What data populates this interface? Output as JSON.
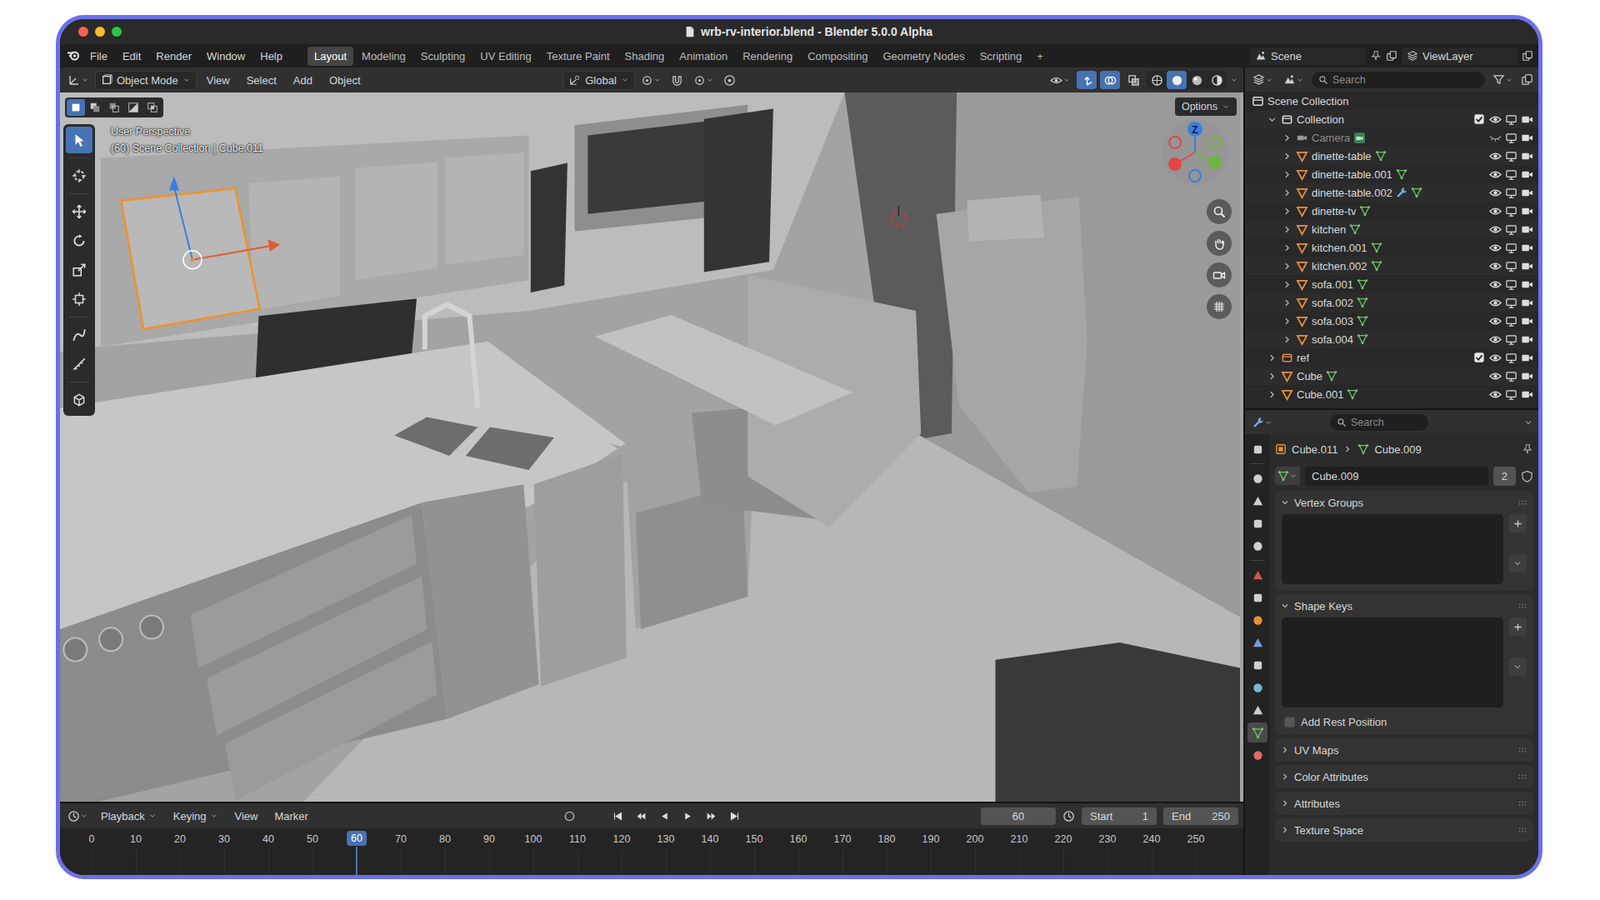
{
  "window": {
    "title": "wrb-rv-interior.blend - Blender 5.0.0 Alpha"
  },
  "menu": [
    "File",
    "Edit",
    "Render",
    "Window",
    "Help"
  ],
  "workspaces": [
    {
      "label": "Layout",
      "selected": true
    },
    {
      "label": "Modeling",
      "selected": false
    },
    {
      "label": "Sculpting",
      "selected": false
    },
    {
      "label": "UV Editing",
      "selected": false
    },
    {
      "label": "Texture Paint",
      "selected": false
    },
    {
      "label": "Shading",
      "selected": false
    },
    {
      "label": "Animation",
      "selected": false
    },
    {
      "label": "Rendering",
      "selected": false
    },
    {
      "label": "Compositing",
      "selected": false
    },
    {
      "label": "Geometry Nodes",
      "selected": false
    },
    {
      "label": "Scripting",
      "selected": false
    }
  ],
  "workspace_add": "+",
  "scene": "Scene",
  "view_layer": "ViewLayer",
  "viewport": {
    "mode": "Object Mode",
    "menus": [
      "View",
      "Select",
      "Add",
      "Object"
    ],
    "orientation": "Global",
    "options": "Options",
    "view_name": "User Perspective",
    "view_info": "(60) Scene Collection | Cube.011",
    "gizmo_axis": "Z",
    "select_modes": [
      {
        "selected": true
      },
      {
        "selected": false
      },
      {
        "selected": false
      },
      {
        "selected": false
      },
      {
        "selected": false
      }
    ],
    "shading": [
      {
        "selected": false
      },
      {
        "selected": true
      },
      {
        "selected": false
      },
      {
        "selected": false
      }
    ],
    "tools": [
      {
        "selected": true
      },
      {
        "selected": false
      },
      {
        "selected": false
      },
      {
        "selected": false
      },
      {
        "selected": false
      },
      {
        "selected": false
      },
      {
        "selected": false
      },
      {
        "selected": false
      },
      {
        "selected": false
      }
    ]
  },
  "outliner": {
    "search": "Search",
    "root": "Scene Collection",
    "tree": [
      {
        "name": "Collection",
        "kind": "collection",
        "color": "#d6d6d6",
        "expanded": true,
        "checked": true,
        "hidden": false,
        "dimmed": false,
        "has_modifier": false,
        "children": [
          {
            "name": "Camera",
            "kind": "camera",
            "expanded": false,
            "hidden": true,
            "dimmed": true,
            "has_modifier": false
          },
          {
            "name": "dinette-table",
            "kind": "mesh",
            "expanded": false,
            "hidden": false,
            "dimmed": false,
            "has_modifier": false
          },
          {
            "name": "dinette-table.001",
            "kind": "mesh",
            "expanded": false,
            "hidden": false,
            "dimmed": false,
            "has_modifier": false
          },
          {
            "name": "dinette-table.002",
            "kind": "mesh",
            "expanded": false,
            "hidden": false,
            "dimmed": false,
            "has_modifier": true
          },
          {
            "name": "dinette-tv",
            "kind": "mesh",
            "expanded": false,
            "hidden": false,
            "dimmed": false,
            "has_modifier": false
          },
          {
            "name": "kitchen",
            "kind": "mesh",
            "expanded": false,
            "hidden": false,
            "dimmed": false,
            "has_modifier": false
          },
          {
            "name": "kitchen.001",
            "kind": "mesh",
            "expanded": false,
            "hidden": false,
            "dimmed": false,
            "has_modifier": false
          },
          {
            "name": "kitchen.002",
            "kind": "mesh",
            "expanded": false,
            "hidden": false,
            "dimmed": false,
            "has_modifier": false
          },
          {
            "name": "sofa.001",
            "kind": "mesh",
            "expanded": false,
            "hidden": false,
            "dimmed": false,
            "has_modifier": false
          },
          {
            "name": "sofa.002",
            "kind": "mesh",
            "expanded": false,
            "hidden": false,
            "dimmed": false,
            "has_modifier": false
          },
          {
            "name": "sofa.003",
            "kind": "mesh",
            "expanded": false,
            "hidden": false,
            "dimmed": false,
            "has_modifier": false
          },
          {
            "name": "sofa.004",
            "kind": "mesh",
            "expanded": false,
            "hidden": false,
            "dimmed": false,
            "has_modifier": false
          }
        ]
      },
      {
        "name": "ref",
        "kind": "collection",
        "color": "#e08a3c",
        "expanded": false,
        "checked": true,
        "hidden": false,
        "dimmed": false,
        "has_modifier": false,
        "children": []
      },
      {
        "name": "Cube",
        "kind": "mesh",
        "expanded": false,
        "hidden": false,
        "dimmed": false,
        "has_modifier": false
      },
      {
        "name": "Cube.001",
        "kind": "mesh",
        "expanded": false,
        "hidden": false,
        "dimmed": false,
        "has_modifier": false
      }
    ]
  },
  "properties": {
    "search": "Search",
    "tabs": [
      {
        "selected": false
      },
      {
        "selected": false
      },
      {
        "selected": false
      },
      {
        "selected": false
      },
      {
        "selected": false
      },
      {
        "selected": false
      },
      {
        "selected": false
      },
      {
        "selected": false
      },
      {
        "selected": false
      },
      {
        "selected": false
      },
      {
        "selected": false
      },
      {
        "selected": false
      },
      {
        "selected": true
      },
      {
        "selected": false
      }
    ],
    "object": "Cube.011",
    "mesh": "Cube.009",
    "datablock": "Cube.009",
    "users": "2",
    "panels": [
      {
        "title": "Vertex Groups",
        "expanded": true,
        "kind": "list"
      },
      {
        "title": "Shape Keys",
        "expanded": true,
        "kind": "list",
        "checkbox": {
          "label": "Add Rest Position",
          "checked": false
        }
      },
      {
        "title": "UV Maps",
        "expanded": false,
        "kind": "plain"
      },
      {
        "title": "Color Attributes",
        "expanded": false,
        "kind": "plain"
      },
      {
        "title": "Attributes",
        "expanded": false,
        "kind": "plain"
      },
      {
        "title": "Texture Space",
        "expanded": false,
        "kind": "plain"
      }
    ]
  },
  "timeline": {
    "menus": [
      {
        "label": "Playback",
        "dropdown": true
      },
      {
        "label": "Keying",
        "dropdown": true
      },
      {
        "label": "View",
        "dropdown": false
      },
      {
        "label": "Marker",
        "dropdown": false
      }
    ],
    "current_frame": "60",
    "start_label": "Start",
    "start": "1",
    "end_label": "End",
    "end": "250",
    "ticks": [
      "0",
      "10",
      "20",
      "30",
      "40",
      "50",
      "70",
      "80",
      "90",
      "100",
      "110",
      "120",
      "130",
      "140",
      "150",
      "160",
      "170",
      "180",
      "190",
      "200",
      "210",
      "220",
      "230",
      "240",
      "250"
    ]
  }
}
